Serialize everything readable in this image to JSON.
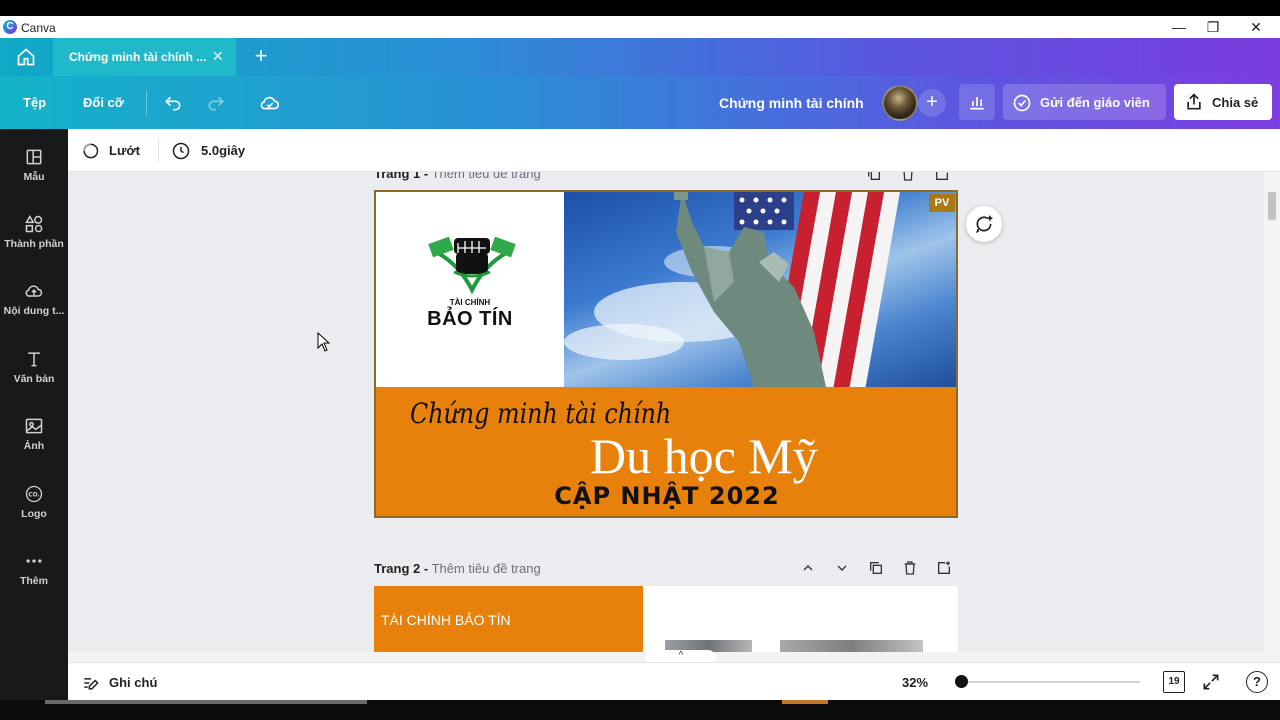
{
  "window": {
    "app_name": "Canva",
    "minimize": "—",
    "maximize": "❐",
    "close": "✕"
  },
  "tabs": {
    "active_label": "Chứng minh tài chính ...",
    "close_glyph": "✕",
    "new_tab_glyph": "+"
  },
  "toolbar": {
    "file_label": "Tệp",
    "resize_label": "Đổi cỡ",
    "document_title": "Chứng minh tài chính",
    "add_glyph": "+",
    "send_teacher_label": "Gửi đến giáo viên",
    "share_label": "Chia sẻ"
  },
  "sidebar": {
    "items": [
      {
        "label": "Mẫu",
        "icon": "templates-icon"
      },
      {
        "label": "Thành phần",
        "icon": "elements-icon"
      },
      {
        "label": "Nội dung t...",
        "icon": "upload-icon"
      },
      {
        "label": "Văn bản",
        "icon": "text-icon"
      },
      {
        "label": "Ảnh",
        "icon": "photo-icon"
      },
      {
        "label": "Logo",
        "icon": "logo-icon"
      },
      {
        "label": "Thêm",
        "icon": "more-icon"
      }
    ]
  },
  "subbar": {
    "transition_label": "Lướt",
    "duration_label": "5.0giây"
  },
  "canvas": {
    "page1": {
      "number": "Trang 1 -",
      "subtitle": "Thêm tiêu đề trang",
      "brand_small": "TÀI CHÍNH",
      "brand_big": "BẢO TÍN",
      "line1": "Chứng minh tài chính",
      "line2": "Du học Mỹ",
      "line3": "CẬP NHẬT 2022",
      "badge": "PV"
    },
    "page2": {
      "number": "Trang 2 -",
      "subtitle": "Thêm tiêu đề trang",
      "heading": "TÀI CHÍNH BẢO TÍN"
    },
    "collapse_glyph": "^"
  },
  "footer": {
    "notes_label": "Ghi chú",
    "zoom_label": "32%",
    "zoom_value": 0.32,
    "pages_count": "19",
    "help_glyph": "?"
  },
  "colors": {
    "orange": "#e8810c",
    "sidebar_bg": "#18191b",
    "toolbar_start": "#13b3c8",
    "toolbar_end": "#7d3ddf"
  }
}
